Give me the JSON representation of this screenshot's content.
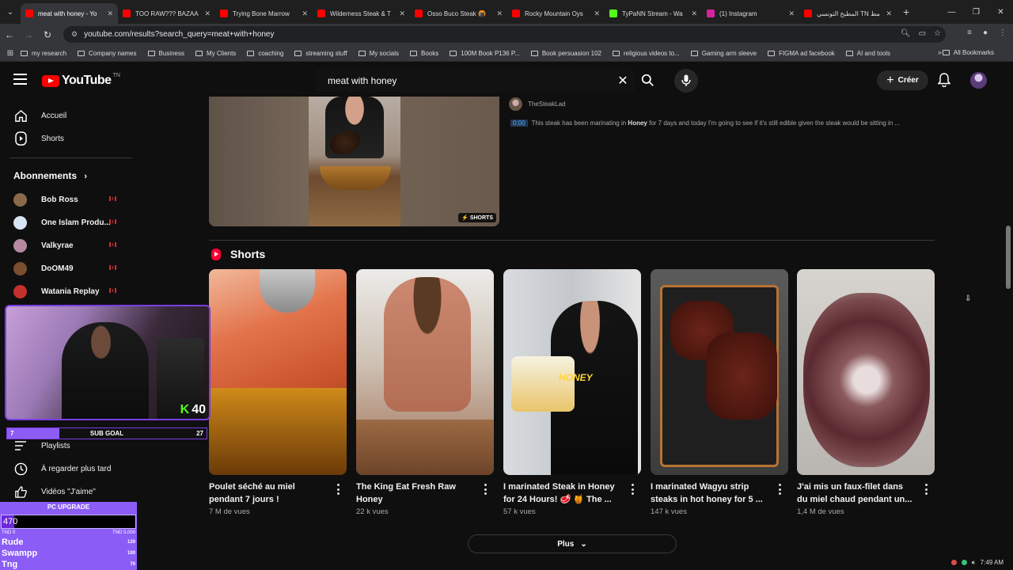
{
  "browser": {
    "tabs": [
      {
        "label": "meat with honey - Yo",
        "fav": "#ff0000",
        "active": true
      },
      {
        "label": "TOO RAW??? BAZAA",
        "fav": "#ff0000"
      },
      {
        "label": "Trying Bone Marrow",
        "fav": "#ff0000"
      },
      {
        "label": "Wilderness Steak & T",
        "fav": "#ff0000"
      },
      {
        "label": "Osso Buco Steak 🍘",
        "fav": "#ff0000"
      },
      {
        "label": "Rocky Mountain Oys",
        "fav": "#ff0000"
      },
      {
        "label": "TyPaNN Stream - Wa",
        "fav": "#53fc18"
      },
      {
        "label": "(1) Instagram",
        "fav": "#d6249f"
      },
      {
        "label": "المطبخ التونسي TN مط",
        "fav": "#ff0000"
      }
    ],
    "url": "youtube.com/results?search_query=meat+with+honey",
    "bookmarks": [
      "my research",
      "Company names",
      "Business",
      "My Clients",
      "coaching",
      "streaming stuff",
      "My socials",
      "Books",
      "100M Book P136 P...",
      "Book persuasion 102",
      "religious videos to...",
      "Gaming arm sleeve",
      "FIGMA ad facebook",
      "AI and tools"
    ],
    "all_bookmarks": "All Bookmarks"
  },
  "header": {
    "logo": "YouTube",
    "country": "TN",
    "query": "meat with honey",
    "create_label": "Créer"
  },
  "sidebar": {
    "home": "Accueil",
    "shorts": "Shorts",
    "subs_heading": "Abonnements",
    "subs": [
      {
        "name": "Bob Ross",
        "color": "#8a6a4a"
      },
      {
        "name": "One Islam Produ...",
        "color": "#d7e4f5"
      },
      {
        "name": "Valkyrae",
        "color": "#b58aa0"
      },
      {
        "name": "DoOM49",
        "color": "#7a4e2e"
      },
      {
        "name": "Watania Replay",
        "color": "#c4302b"
      }
    ],
    "playlists": "Playlists",
    "watch_later": "À regarder plus tard",
    "liked": "Vidéos \"J'aime\""
  },
  "result": {
    "channel": "TheSteakLad",
    "shorts_badge": "SHORTS",
    "timestamp": "0:00",
    "snippet_pre": "This steak has been marinating in ",
    "snippet_bold": "Honey",
    "snippet_post": " for 7 days and today I'm going to see if it's still edible given the steak would be sitting in ..."
  },
  "shorts": {
    "heading": "Shorts",
    "items": [
      {
        "title": "Poulet séché au miel pendant 7 jours !",
        "views": "7 M de vues"
      },
      {
        "title": "The King Eat Fresh Raw Honey",
        "views": "22 k vues"
      },
      {
        "title": "I marinated Steak in Honey for 24 Hours! 🥩 🍯 The ...",
        "views": "57 k vues"
      },
      {
        "title": "I marinated Wagyu strip steaks in hot honey for 5 ...",
        "views": "147 k vues"
      },
      {
        "title": "J'ai mis un faux-filet dans du miel chaud pendant un...",
        "views": "1,4 M de vues"
      }
    ],
    "more_label": "Plus"
  },
  "overlay": {
    "webcam_count": "40",
    "subgoal": {
      "left": "7",
      "label": "SUB GOAL",
      "right": "27",
      "progress": 0.26
    },
    "pc_upgrade": {
      "title": "PC UPGRADE",
      "value": "470",
      "min": "TND 0",
      "max": "TND 5,000",
      "progress": 0.094,
      "leaders": [
        {
          "name": "Rude",
          "score": "120"
        },
        {
          "name": "Swampp",
          "score": "100"
        },
        {
          "name": "Tng",
          "score": "70"
        }
      ]
    }
  },
  "system": {
    "time": "7:49 AM"
  },
  "colors": {
    "accent": "#ff0000",
    "kick": "#53fc18",
    "overlay": "#8b5cf6"
  }
}
